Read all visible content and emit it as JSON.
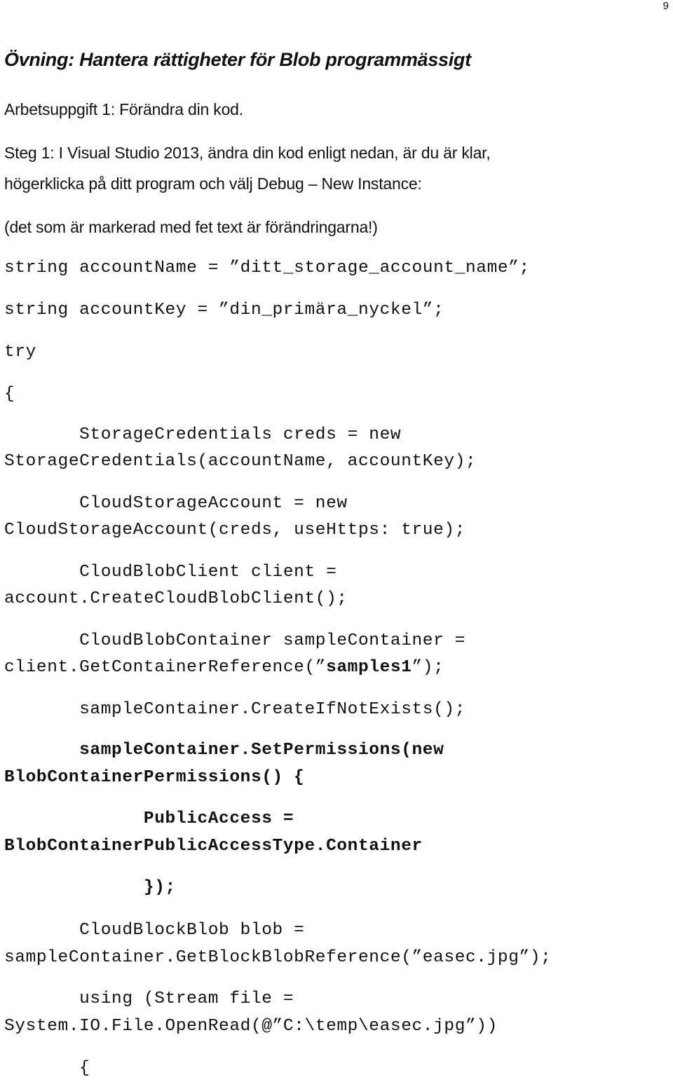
{
  "page_number": "9",
  "heading": "Övning: Hantera rättigheter för Blob programmässigt",
  "task": "Arbetsuppgift 1: Förändra din kod.",
  "step_line1": "Steg 1: I Visual Studio 2013, ändra din kod enligt nedan, är du är klar,",
  "step_line2": "högerklicka på ditt program och välj Debug – New Instance:",
  "note": "(det som är markerad med fet text är förändringarna!)",
  "code": {
    "l1": "string accountName = ”ditt_storage_account_name”;",
    "l2": "string accountKey = ”din_primära_nyckel”;",
    "l3": "try",
    "l4": "{",
    "l5a": "       StorageCredentials creds = new",
    "l5b": "StorageCredentials(accountName, accountKey);",
    "l6a": "       CloudStorageAccount = new",
    "l6b": "CloudStorageAccount(creds, useHttps: true);",
    "l7a": "       CloudBlobClient client =",
    "l7b": "account.CreateCloudBlobClient();",
    "l8a": "       CloudBlobContainer sampleContainer =",
    "l8b_pre": "client.GetContainerReference(”",
    "l8b_bold": "samples1",
    "l8b_post": "”);",
    "l9": "       sampleContainer.CreateIfNotExists();",
    "l10a": "       sampleContainer.SetPermissions(new",
    "l10b": "BlobContainerPermissions() {",
    "l11a": "             PublicAccess =",
    "l11b": "BlobContainerPublicAccessType.Container",
    "l12": "             });",
    "l13a": "       CloudBlockBlob blob =",
    "l13b": "sampleContainer.GetBlockBlobReference(”easec.jpg”);",
    "l14a": "       using (Stream file =",
    "l14b": "System.IO.File.OpenRead(@”C:\\temp\\easec.jpg”))",
    "l15": "       {"
  }
}
